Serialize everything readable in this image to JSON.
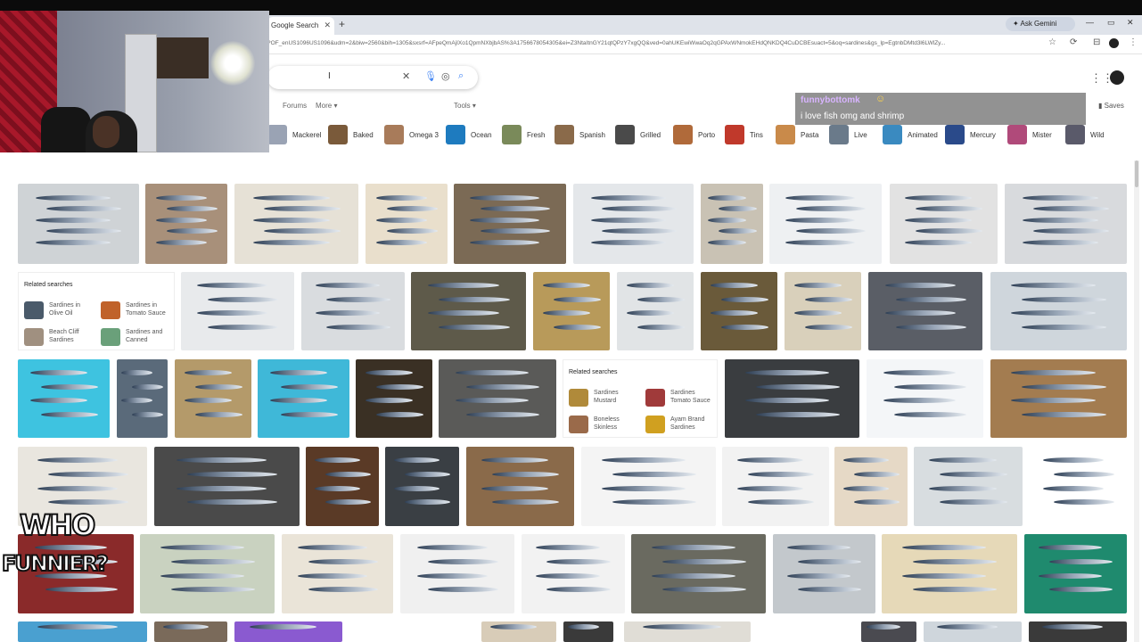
{
  "browser": {
    "tab_title": "Google Search",
    "new_tab": "+",
    "ask_gemini": "✦ Ask Gemini",
    "url": "?OF_enUS1096US1096&udm=2&biw=2560&bih=1305&sxsrf=AFpeQmAjIXo1QpmNXbjbAS%3A1756678054305&ei=Z3NtaItnGY21qtQPzY7xgQQ&ved=0ahUKEwiWwaOq2qGPAxWNmokEHdQNKDQ4CuDCBEsuact=5&oq=sardines&gs_lp=EgtnbDMtd3l6LWlZy...",
    "min": "—",
    "restore": "▭",
    "close": "✕"
  },
  "search": {
    "query": "I",
    "clear_icon": "close-icon",
    "mic_icon": "mic-icon",
    "lens_icon": "lens-icon",
    "search_icon": "search-icon"
  },
  "filters": {
    "forums": "Forums",
    "more": "More ▾",
    "tools": "Tools ▾",
    "saves": "Saves"
  },
  "chips": [
    {
      "label": "Mackerel",
      "color": "#9aa3b4"
    },
    {
      "label": "Baked",
      "color": "#7a5a3a"
    },
    {
      "label": "Omega 3",
      "color": "#a87b5a"
    },
    {
      "label": "Ocean",
      "color": "#1e7bbf"
    },
    {
      "label": "Fresh",
      "color": "#7a8a5a"
    },
    {
      "label": "Spanish",
      "color": "#8a6a4a"
    },
    {
      "label": "Grilled",
      "color": "#4a4a4a"
    },
    {
      "label": "Porto",
      "color": "#b06a3a"
    },
    {
      "label": "Tins",
      "color": "#c0392b"
    },
    {
      "label": "Pasta",
      "color": "#c98a4a"
    },
    {
      "label": "Live",
      "color": "#6a7a8a"
    },
    {
      "label": "Animated",
      "color": "#3a8ac0"
    },
    {
      "label": "Mercury",
      "color": "#2a4a8a"
    },
    {
      "label": "Mister",
      "color": "#b04a7a"
    },
    {
      "label": "Wild",
      "color": "#5a5a6a"
    }
  ],
  "chat": {
    "username": "funnybottomk",
    "message": "i love fish omg and shrimp",
    "emote": "☺"
  },
  "related_1": {
    "title": "Related searches",
    "items": [
      {
        "line1": "Sardines in",
        "line2": "Olive Oil",
        "color": "#4a5a6a"
      },
      {
        "line1": "Sardines in",
        "line2": "Tomato Sauce",
        "color": "#c0622a"
      },
      {
        "line1": "Beach Cliff",
        "line2": "Sardines",
        "color": "#a09080"
      },
      {
        "line1": "Sardines and",
        "line2": "Canned",
        "color": "#6aa07a"
      }
    ]
  },
  "related_2": {
    "title": "Related searches",
    "items": [
      {
        "line1": "Sardines",
        "line2": "Mustard",
        "color": "#b08a3a"
      },
      {
        "line1": "Sardines",
        "line2": "Tomato Sauce",
        "color": "#a03a3a"
      },
      {
        "line1": "Boneless",
        "line2": "Skinless",
        "color": "#9a6a4a"
      },
      {
        "line1": "Ayam Brand",
        "line2": "Sardines",
        "color": "#d0a020"
      }
    ]
  },
  "overlay_logo": {
    "line1": "WHO",
    "line2": "FUNNIER?"
  },
  "colors": {
    "accent_blue": "#4285f4",
    "chat_name": "#d8b4ff"
  }
}
